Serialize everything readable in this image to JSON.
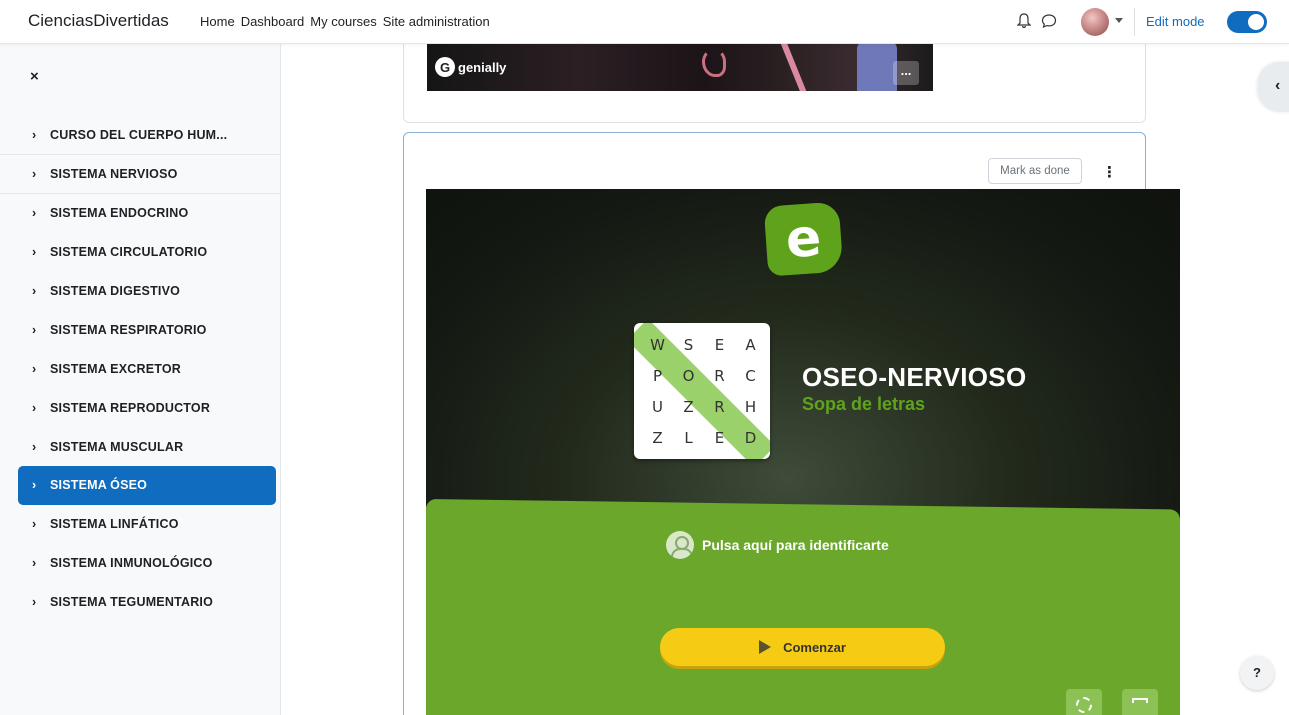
{
  "navbar": {
    "brand": "CienciasDivertidas",
    "links": [
      "Home",
      "Dashboard",
      "My courses",
      "Site administration"
    ],
    "edit_mode_label": "Edit mode",
    "edit_mode_on": true
  },
  "sidebar": {
    "close_icon": "×",
    "items": [
      {
        "label": "CURSO DEL CUERPO HUM...",
        "active": false
      },
      {
        "label": "SISTEMA NERVIOSO",
        "active": false
      },
      {
        "label": "SISTEMA ENDOCRINO",
        "active": false
      },
      {
        "label": "SISTEMA CIRCULATORIO",
        "active": false
      },
      {
        "label": "SISTEMA DIGESTIVO",
        "active": false
      },
      {
        "label": "SISTEMA RESPIRATORIO",
        "active": false
      },
      {
        "label": "SISTEMA EXCRETOR",
        "active": false
      },
      {
        "label": "SISTEMA REPRODUCTOR",
        "active": false
      },
      {
        "label": "SISTEMA MUSCULAR",
        "active": false
      },
      {
        "label": "SISTEMA ÓSEO",
        "active": true
      },
      {
        "label": "SISTEMA LINFÁTICO",
        "active": false
      },
      {
        "label": "SISTEMA INMUNOLÓGICO",
        "active": false
      },
      {
        "label": "SISTEMA TEGUMENTARIO",
        "active": false
      }
    ]
  },
  "genially": {
    "logo_text": "genially",
    "more_label": "..."
  },
  "activity_card": {
    "mark_done_label": "Mark as done"
  },
  "educaplay": {
    "logo_letter": "e",
    "grid_letters": [
      "W",
      "S",
      "E",
      "A",
      "P",
      "O",
      "R",
      "C",
      "U",
      "Z",
      "R",
      "H",
      "Z",
      "L",
      "E",
      "D"
    ],
    "title": "OSEO-NERVIOSO",
    "subtitle": "Sopa de letras",
    "login_text": "Pulsa aquí para identificarte",
    "start_label": "Comenzar",
    "brand_color": "#5fa31c",
    "button_color": "#f6cb14"
  },
  "help_label": "?",
  "icons": [
    "bell-icon",
    "chat-icon",
    "close-icon",
    "chevron-right-icon",
    "kebab-icon",
    "user-icon",
    "play-icon",
    "gear-icon",
    "fullscreen-icon",
    "chevron-left-icon"
  ]
}
